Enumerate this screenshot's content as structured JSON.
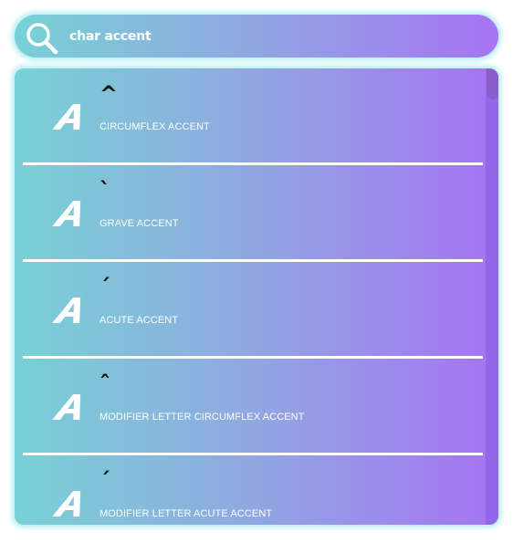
{
  "search": {
    "value": "char accent",
    "icon": "search-icon"
  },
  "results": [
    {
      "char": "^",
      "name": "CIRCUMFLEX ACCENT",
      "icon": "character-icon"
    },
    {
      "char": "`",
      "name": "GRAVE ACCENT",
      "icon": "character-icon"
    },
    {
      "char": "´",
      "name": "ACUTE ACCENT",
      "icon": "character-icon"
    },
    {
      "char": "ˆ",
      "name": "MODIFIER LETTER CIRCUMFLEX ACCENT",
      "icon": "character-icon"
    },
    {
      "char": "ˊ",
      "name": "MODIFIER LETTER ACUTE ACCENT",
      "icon": "character-icon"
    }
  ],
  "colors": {
    "gradient_start": "#78d1d5",
    "gradient_end": "#a673f4",
    "border_glow": "#c6f3f6",
    "scrollbar": "#9466e8"
  }
}
